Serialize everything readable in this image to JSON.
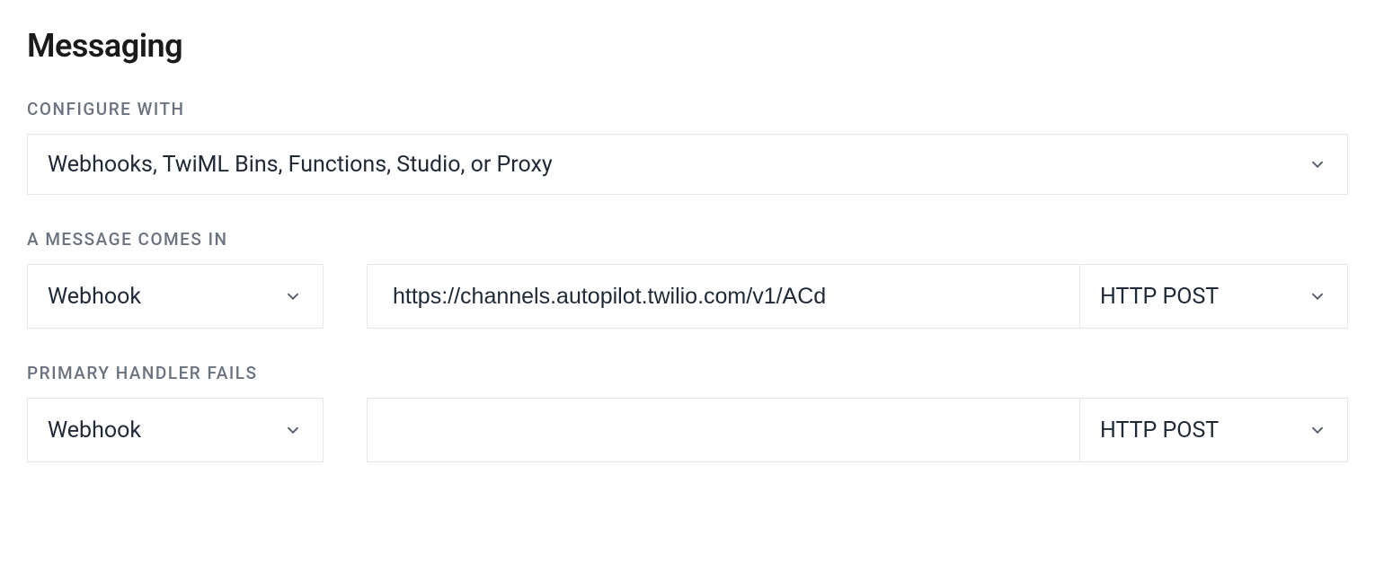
{
  "section": {
    "title": "Messaging"
  },
  "configure_with": {
    "label": "CONFIGURE WITH",
    "selected": "Webhooks, TwiML Bins, Functions, Studio, or Proxy"
  },
  "message_comes_in": {
    "label": "A MESSAGE COMES IN",
    "handler_type": "Webhook",
    "url": "https://channels.autopilot.twilio.com/v1/ACd",
    "method": "HTTP POST"
  },
  "primary_handler_fails": {
    "label": "PRIMARY HANDLER FAILS",
    "handler_type": "Webhook",
    "url": "",
    "method": "HTTP POST"
  }
}
